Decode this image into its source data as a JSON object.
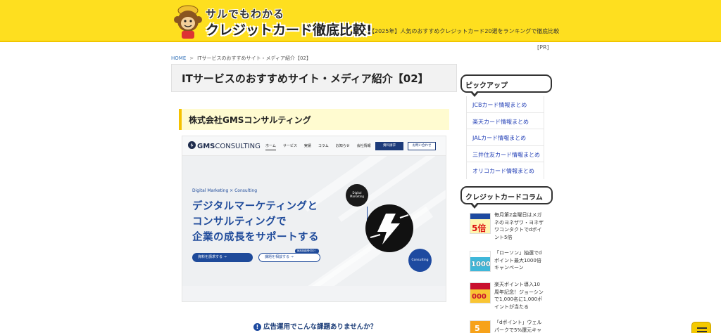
{
  "header": {
    "logo_line1": "サルでもわかる",
    "logo_line2": "クレジットカード徹底比較!",
    "tagline": "【2025年】人気のおすすめクレジットカード20選をランキングで徹底比較",
    "pr_label": "[PR]"
  },
  "breadcrumb": {
    "home": "HOME",
    "separator": ">",
    "current": "ITサービスのおすすめサイト・メディア紹介【02】"
  },
  "page_title": "ITサービスのおすすめサイト・メディア紹介【02】",
  "section": {
    "heading": "株式会社GMSコンサルティング",
    "screenshot": {
      "logo_strong": "GMS",
      "logo_light": "CONSULTING",
      "menu": [
        "ホーム",
        "サービス",
        "実績",
        "コラム",
        "お知らせ",
        "会社情報"
      ],
      "download_button": "資料請求",
      "contact_button": "お問い合わせ",
      "sub_en": "Digital Marketing × Consulting",
      "headline_1": "デジタルマーケティングと",
      "headline_2": "コンサルティングで",
      "headline_3": "企業の成長をサポートする",
      "cta_1": "資料を請求する",
      "cta_2": "課題を相談する",
      "cta_tag": "無料相談受付中！",
      "bubble_dm": "Digital Marketing",
      "bubble_c": "Consulting"
    },
    "question": "広告運用でこんな課題ありませんか？",
    "question_icon": "!"
  },
  "sidebar": {
    "pickup_title": "ピックアップ",
    "pickup_items": [
      "JCBカード情報まとめ",
      "楽天カード情報まとめ",
      "JALカード情報まとめ",
      "三井住友カード情報まとめ",
      "オリコカード情報まとめ"
    ],
    "column_title": "クレジットカードコラム",
    "column_items": [
      {
        "text": "毎月第2金曜日はメガネのヨネザワ・ヨネザワコンタクトでdポイント5倍",
        "thumb_label": "5倍"
      },
      {
        "text": "「ローソン」抽選でdポイント最大1000倍キャンペーン",
        "thumb_label": "1000"
      },
      {
        "text": "楽天ポイント導入10周年記念！ジョーシンで1,000名に1,000ポイントが当たる",
        "thumb_label": "000"
      },
      {
        "text": "「dポイント」ウェルパークで5%還元キャン",
        "thumb_label": "5"
      }
    ]
  },
  "colors": {
    "header_yellow": "#fedf1f",
    "link_blue": "#2844b8",
    "brand_navy": "#1e4a9a",
    "accent_gold": "#f5c200"
  },
  "icons": {
    "monkey": "monkey-mascot-icon",
    "menu": "hamburger-icon"
  }
}
